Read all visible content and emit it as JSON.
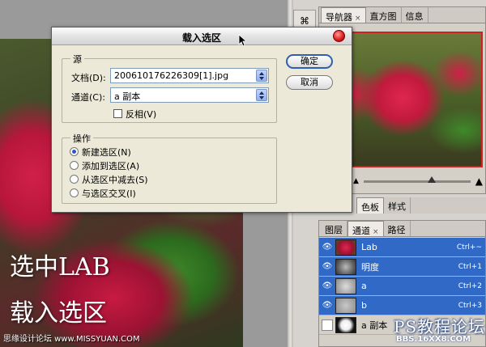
{
  "dialog": {
    "title": "载入选区",
    "source_legend": "源",
    "document_label": "文档(D):",
    "document_value": "200610176226309[1].jpg",
    "channel_label": "通道(C):",
    "channel_value": "a 副本",
    "invert_label": "反相(V)",
    "invert_checked": false,
    "operation_legend": "操作",
    "operations": [
      {
        "label": "新建选区(N)",
        "selected": true
      },
      {
        "label": "添加到选区(A)",
        "selected": false
      },
      {
        "label": "从选区中减去(S)",
        "selected": false
      },
      {
        "label": "与选区交叉(I)",
        "selected": false
      }
    ],
    "ok_label": "确定",
    "cancel_label": "取消"
  },
  "navigator": {
    "tabs": [
      "导航器",
      "直方图",
      "信息"
    ],
    "active_tab": "导航器"
  },
  "color_tabs": [
    "色板",
    "样式"
  ],
  "channels_panel": {
    "tabs": [
      "图层",
      "通道",
      "路径"
    ],
    "active_tab": "通道",
    "rows": [
      {
        "name": "Lab",
        "shortcut": "Ctrl+~",
        "selected": true
      },
      {
        "name": "明度",
        "shortcut": "Ctrl+1",
        "selected": true
      },
      {
        "name": "a",
        "shortcut": "Ctrl+2",
        "selected": true
      },
      {
        "name": "b",
        "shortcut": "Ctrl+3",
        "selected": true
      },
      {
        "name": "a 副本",
        "shortcut": "",
        "selected": false
      }
    ]
  },
  "overlay": {
    "line1": "选中LAB",
    "line2": "载入选区",
    "watermark_left": "思缘设计论坛  www.MISSYUAN.COM",
    "watermark_right": "PS教程论坛",
    "watermark_right_url": "BBS.16XX8.COM"
  },
  "mini_strip_icon": "brush-icon",
  "colors": {
    "selection_blue": "#3169c6",
    "dialog_bg": "#ece9d8",
    "close_red": "#e02020"
  }
}
